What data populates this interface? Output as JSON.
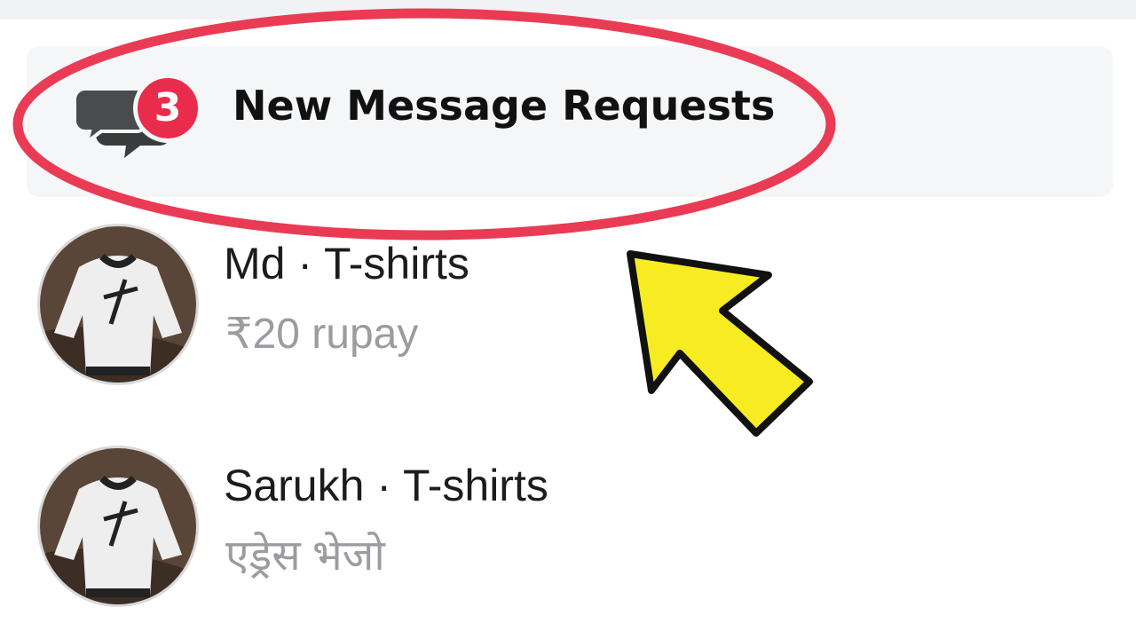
{
  "message_requests": {
    "count": "3",
    "label": "New Message Requests"
  },
  "threads": [
    {
      "name": "Md · T-shirts",
      "preview": "₹20 rupay"
    },
    {
      "name": "Sarukh · T-shirts",
      "preview": "एड्रेस भेजो"
    }
  ],
  "colors": {
    "badge": "#ea2c4c",
    "highlight_oval": "#ea3b55",
    "arrow_fill": "#f7ec22",
    "arrow_outline": "#111111",
    "preview_text": "#9a9ca0"
  },
  "icons": {
    "requests": "chat-bubbles-icon",
    "pointer": "yellow-arrow-annotation"
  }
}
